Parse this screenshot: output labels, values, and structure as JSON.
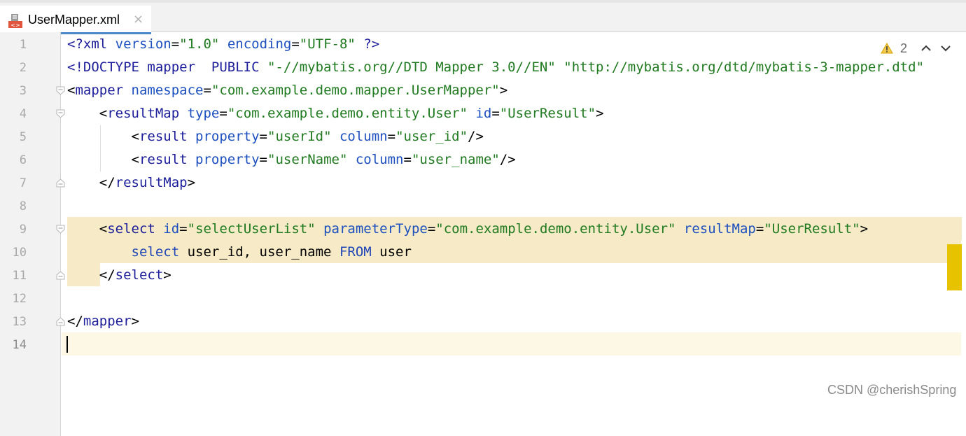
{
  "tab": {
    "title": "UserMapper.xml",
    "close_glyph": "×",
    "icon": "xml-file-icon"
  },
  "inspections": {
    "warning_count": "2",
    "warning_icon": "warning-icon"
  },
  "code_lines": [
    {
      "n": "1",
      "parts": [
        [
          "tag",
          "<?xml "
        ],
        [
          "attr",
          "version"
        ],
        [
          "plain",
          "="
        ],
        [
          "str",
          "\"1.0\""
        ],
        [
          "plain",
          " "
        ],
        [
          "attr",
          "encoding"
        ],
        [
          "plain",
          "="
        ],
        [
          "str",
          "\"UTF-8\""
        ],
        [
          "tag",
          " ?>"
        ]
      ]
    },
    {
      "n": "2",
      "parts": [
        [
          "tag",
          "<!DOCTYPE mapper  PUBLIC "
        ],
        [
          "str",
          "\"-//mybatis.org//DTD Mapper 3.0//EN\""
        ],
        [
          "plain",
          " "
        ],
        [
          "str",
          "\"http://mybatis.org/dtd/mybatis-3-mapper.dtd\""
        ]
      ]
    },
    {
      "n": "3",
      "parts": [
        [
          "plain",
          "<"
        ],
        [
          "tag",
          "mapper "
        ],
        [
          "attr",
          "namespace"
        ],
        [
          "plain",
          "="
        ],
        [
          "str",
          "\"com.example.demo.mapper.UserMapper\""
        ],
        [
          "plain",
          ">"
        ]
      ]
    },
    {
      "n": "4",
      "parts": [
        [
          "plain",
          "    <"
        ],
        [
          "tag",
          "resultMap "
        ],
        [
          "attr",
          "type"
        ],
        [
          "plain",
          "="
        ],
        [
          "str",
          "\"com.example.demo.entity.User\""
        ],
        [
          "plain",
          " "
        ],
        [
          "attr",
          "id"
        ],
        [
          "plain",
          "="
        ],
        [
          "str",
          "\"UserResult\""
        ],
        [
          "plain",
          ">"
        ]
      ]
    },
    {
      "n": "5",
      "parts": [
        [
          "plain",
          "        <"
        ],
        [
          "tag",
          "result "
        ],
        [
          "attr",
          "property"
        ],
        [
          "plain",
          "="
        ],
        [
          "str",
          "\"userId\""
        ],
        [
          "plain",
          " "
        ],
        [
          "attr",
          "column"
        ],
        [
          "plain",
          "="
        ],
        [
          "str",
          "\"user_id\""
        ],
        [
          "plain",
          "/>"
        ]
      ]
    },
    {
      "n": "6",
      "parts": [
        [
          "plain",
          "        <"
        ],
        [
          "tag",
          "result "
        ],
        [
          "attr",
          "property"
        ],
        [
          "plain",
          "="
        ],
        [
          "str",
          "\"userName\""
        ],
        [
          "plain",
          " "
        ],
        [
          "attr",
          "column"
        ],
        [
          "plain",
          "="
        ],
        [
          "str",
          "\"user_name\""
        ],
        [
          "plain",
          "/>"
        ]
      ]
    },
    {
      "n": "7",
      "parts": [
        [
          "plain",
          "    </"
        ],
        [
          "tag",
          "resultMap"
        ],
        [
          "plain",
          ">"
        ]
      ]
    },
    {
      "n": "8",
      "parts": []
    },
    {
      "n": "9",
      "parts": [
        [
          "plain",
          "    <"
        ],
        [
          "tag",
          "select "
        ],
        [
          "attr",
          "id"
        ],
        [
          "plain",
          "="
        ],
        [
          "str",
          "\"selectUserList\""
        ],
        [
          "plain",
          " "
        ],
        [
          "attr",
          "parameterType"
        ],
        [
          "plain",
          "="
        ],
        [
          "str",
          "\"com.example.demo.entity.User\""
        ],
        [
          "plain",
          " "
        ],
        [
          "attr",
          "resultMap"
        ],
        [
          "plain",
          "="
        ],
        [
          "str",
          "\"UserResult\""
        ],
        [
          "plain",
          ">"
        ]
      ]
    },
    {
      "n": "10",
      "parts": [
        [
          "plain",
          "        "
        ],
        [
          "kw",
          "select "
        ],
        [
          "plain",
          "user_id, user_name "
        ],
        [
          "kw",
          "FROM "
        ],
        [
          "plain",
          "user"
        ]
      ]
    },
    {
      "n": "11",
      "parts": [
        [
          "plain",
          "    </"
        ],
        [
          "tag",
          "select"
        ],
        [
          "plain",
          ">"
        ]
      ]
    },
    {
      "n": "12",
      "parts": []
    },
    {
      "n": "13",
      "parts": [
        [
          "plain",
          "</"
        ],
        [
          "tag",
          "mapper"
        ],
        [
          "plain",
          ">"
        ]
      ]
    },
    {
      "n": "14",
      "parts": []
    }
  ],
  "watermark": "CSDN @cherishSpring"
}
